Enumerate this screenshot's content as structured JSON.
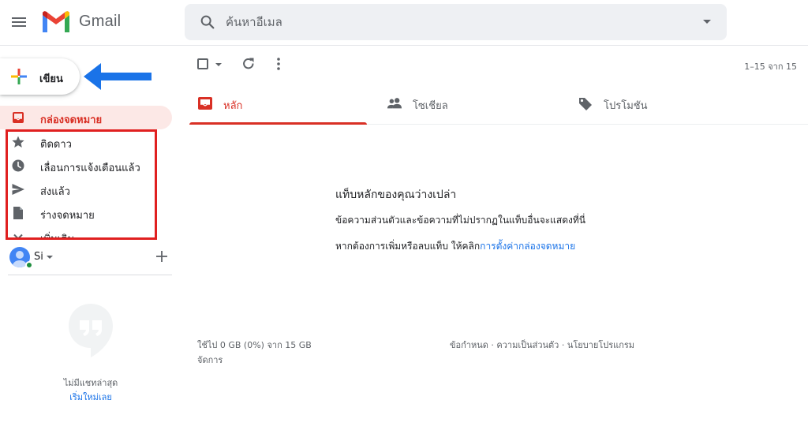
{
  "app": {
    "name": "Gmail"
  },
  "search": {
    "placeholder": "ค้นหาอีเมล"
  },
  "compose": {
    "label": "เขียน"
  },
  "nav": {
    "items": [
      {
        "label": "กล่องจดหมาย",
        "icon": "inbox-icon",
        "active": true
      },
      {
        "label": "ติดดาว",
        "icon": "star-icon"
      },
      {
        "label": "เลื่อนการแจ้งเตือนแล้ว",
        "icon": "clock-icon"
      },
      {
        "label": "ส่งแล้ว",
        "icon": "send-icon"
      },
      {
        "label": "ร่างจดหมาย",
        "icon": "draft-icon"
      },
      {
        "label": "เพิ่มเติม",
        "icon": "chevron-down-icon"
      }
    ]
  },
  "account": {
    "name": "Si"
  },
  "hangouts": {
    "empty_text": "ไม่มีแชทล่าสุด",
    "start_link": "เริ่มใหม่เลย"
  },
  "toolbar": {
    "page_range": "1–15 จาก 15"
  },
  "tabs": [
    {
      "label": "หลัก",
      "icon": "inbox-icon",
      "active": true
    },
    {
      "label": "โซเชียล",
      "icon": "people-icon"
    },
    {
      "label": "โปรโมชัน",
      "icon": "tag-icon"
    }
  ],
  "empty_state": {
    "title": "แท็บหลักของคุณว่างเปล่า",
    "line1": "ข้อความส่วนตัวและข้อความที่ไม่ปรากฏในแท็บอื่นจะแสดงที่นี่",
    "line2_prefix": "หากต้องการเพิ่มหรือลบแท็บ ให้คลิก",
    "line2_link": "การตั้งค่ากล่องจดหมาย"
  },
  "footer": {
    "storage": "ใช้ไป 0 GB (0%) จาก 15 GB",
    "manage": "จัดการ",
    "terms": "ข้อกำหนด",
    "privacy": "ความเป็นส่วนตัว",
    "program_policy": "นโยบายโปรแกรม",
    "separator": " · "
  },
  "colors": {
    "accent_red": "#d93025",
    "active_bg": "#fce8e6",
    "link_blue": "#1a73e8",
    "annotation_box": "#e02020",
    "annotation_arrow": "#1a73e8"
  }
}
